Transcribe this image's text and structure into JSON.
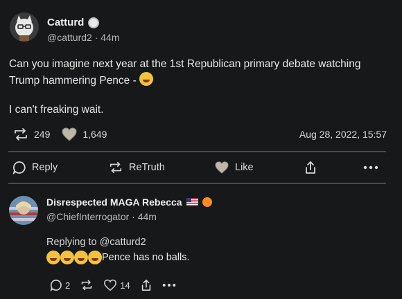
{
  "post": {
    "author_name": "Catturd",
    "author_handle": "@catturd2",
    "time": "44m",
    "text_line1": "Can you imagine next year at the 1st Republican primary debate watching",
    "text_line2": "Trump hammering Pence - ",
    "text_line3": "I can't freaking wait.",
    "retweets": "249",
    "likes": "1,649",
    "timestamp": "Aug 28, 2022, 15:57"
  },
  "actions": {
    "reply": "Reply",
    "retruth": "ReTruth",
    "like": "Like"
  },
  "reply_post": {
    "author_name": "Disrespected MAGA Rebecca",
    "author_handle": "@ChiefInterrogator",
    "time": "44m",
    "replying_to": "Replying to @catturd2",
    "text": "Pence has no balls.",
    "reply_count": "2",
    "like_count": "14"
  },
  "colors": {
    "background": "#17181a",
    "divider": "#4b4b47",
    "accent_orange": "#ff8c1a"
  }
}
